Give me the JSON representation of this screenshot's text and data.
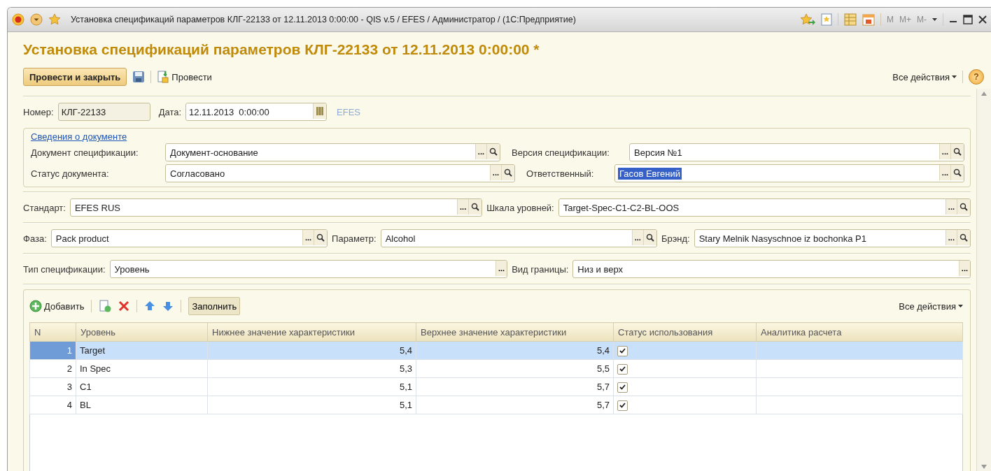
{
  "window": {
    "title": "Установка спецификаций параметров КЛГ-22133 от 12.11.2013 0:00:00 - QIS v.5 / EFES / Администратор /  (1С:Предприятие)",
    "memory_buttons": [
      {
        "label": "M",
        "disabled": true
      },
      {
        "label": "M+",
        "disabled": true
      },
      {
        "label": "M-",
        "disabled": true
      }
    ]
  },
  "header": {
    "title": "Установка спецификаций параметров КЛГ-22133 от 12.11.2013 0:00:00 *"
  },
  "toolbar": {
    "primary": "Провести и закрыть",
    "post": "Провести",
    "all_actions": "Все действия",
    "help": "?"
  },
  "number": {
    "label": "Номер:",
    "value": "КЛГ-22133"
  },
  "date": {
    "label": "Дата:",
    "value": "12.11.2013  0:00:00"
  },
  "organization": "EFES",
  "document_info": {
    "link": "Сведения о документе",
    "rows": [
      [
        {
          "label": "Документ спецификации:",
          "value": "Документ-основание",
          "dots": "...",
          "search": true,
          "text_selected": false
        },
        {
          "label": "Версия спецификации:",
          "value": "Версия №1",
          "dots": "...",
          "search": true,
          "text_selected": false
        }
      ],
      [
        {
          "label": "Статус документа:",
          "value": "Согласовано",
          "dots": "...",
          "search": true,
          "text_selected": false
        },
        {
          "label": "Ответственный:",
          "value": "Гасов Евгений",
          "dots": "...",
          "search": true,
          "text_selected": true
        }
      ]
    ]
  },
  "rows": [
    [
      {
        "label": "Стандарт:",
        "value": "EFES RUS",
        "dots": "...",
        "search": true,
        "text_selected": false
      },
      {
        "label": "Шкала уровней:",
        "value": "Target-Spec-C1-C2-BL-OOS",
        "dots": "...",
        "search": true,
        "text_selected": false
      }
    ],
    [
      {
        "label": "Фаза:",
        "value": "Pack product",
        "dots": "...",
        "search": true,
        "text_selected": false
      },
      {
        "label": "Параметр:",
        "value": "Alcohol",
        "dots": "...",
        "search": true,
        "text_selected": false
      },
      {
        "label": "Брэнд:",
        "value": "Stary Melnik Nasyschnoe iz bochonka P1",
        "dots": "...",
        "search": true,
        "text_selected": false
      }
    ],
    [
      {
        "label": "Тип спецификации:",
        "value": "Уровень",
        "dots": "...",
        "search": false,
        "text_selected": false
      },
      {
        "label": "Вид границы:",
        "value": "Низ и верх",
        "dots": "...",
        "search": false,
        "text_selected": false
      }
    ]
  ],
  "table": {
    "add": "Добавить",
    "fill": "Заполнить",
    "all_actions": "Все действия",
    "columns": [
      "N",
      "Уровень",
      "Нижнее значение характеристики",
      "Верхнее значение характеристики",
      "Статус использования",
      "Аналитика расчета"
    ],
    "rows": [
      {
        "n": "1",
        "level": "Target",
        "low": "5,4",
        "high": "5,4",
        "used": true,
        "selected": true
      },
      {
        "n": "2",
        "level": "In Spec",
        "low": "5,3",
        "high": "5,5",
        "used": true,
        "selected": false
      },
      {
        "n": "3",
        "level": "C1",
        "low": "5,1",
        "high": "5,7",
        "used": true,
        "selected": false
      },
      {
        "n": "4",
        "level": "BL",
        "low": "5,1",
        "high": "5,7",
        "used": true,
        "selected": false
      }
    ]
  }
}
